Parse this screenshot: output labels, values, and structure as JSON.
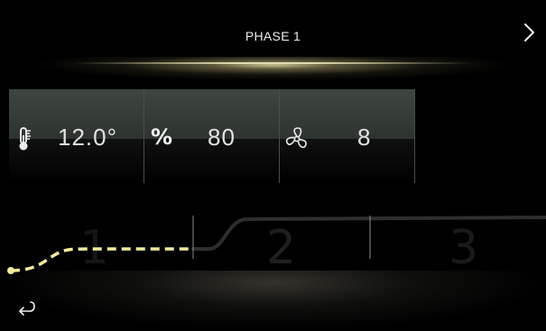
{
  "header": {
    "title": "PHASE 1",
    "next_icon": "chevron-right-icon"
  },
  "readouts": [
    {
      "icon": "thermometer-icon",
      "value": "12.0°"
    },
    {
      "icon": "percent-icon",
      "symbol": "%",
      "value": "80"
    },
    {
      "icon": "fan-icon",
      "value": "8"
    }
  ],
  "phases": {
    "labels": [
      "1",
      "2",
      "3"
    ],
    "active_phase": 1,
    "active_color": "#f2eaa0",
    "inactive_color": "#2c2c2c"
  },
  "footer": {
    "back_icon": "return-arrow-icon"
  },
  "colors": {
    "background": "#000000",
    "tile_band": "#3a403c",
    "accent_glow": "#ddd6a0"
  }
}
